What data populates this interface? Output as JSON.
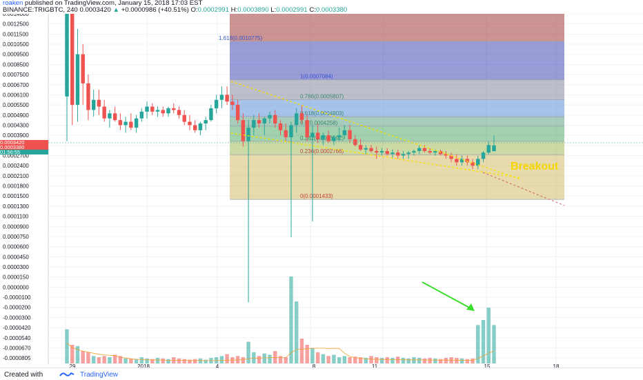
{
  "header": {
    "author": "roaken",
    "published_text": "published on TradingView.com, January 15, 2018 17:03 EST",
    "symbol": "BINANCE:TRIGBTC, 240",
    "last_price": "0.0003420",
    "change": "+0.0000986 (+40.51%)",
    "o_label": "O:",
    "o_value": "0.0002991",
    "h_label": "H:",
    "h_value": "0.0003890",
    "l_label": "L:",
    "l_value": "0.0002991",
    "c_label": "C:",
    "c_value": "0.0003380"
  },
  "price_badges": {
    "badge1": "0.0003420",
    "badge2": "0.0003380",
    "badge3": "01:56:55"
  },
  "footer": {
    "created_with": "Created with",
    "brand": "TradingView"
  },
  "colors": {
    "up": "#26a69a",
    "down": "#ef5350",
    "trendline": "#f6e000",
    "arrow": "#3bdc2c",
    "annotation": "#f6d400"
  },
  "chart_data": {
    "type": "candlestick",
    "title": "",
    "symbol": "BINANCE:TRIGBTC",
    "interval": "240",
    "y_axis_ticks": [
      "0.0014000",
      "0.0012500",
      "0.0011500",
      "0.0010500",
      "0.0009500",
      "0.0008500",
      "0.0007500",
      "0.0006700",
      "0.0006100",
      "0.0005500",
      "0.0004900",
      "0.0004300",
      "0.0003900",
      "0.0003380",
      "0.0002700",
      "0.0002400",
      "0.0002100",
      "0.0001800",
      "0.0001500",
      "0.0001300",
      "0.0001100",
      "0.0000900",
      "0.0000750",
      "0.0000600",
      "0.0000450",
      "0.0000300",
      "0.0000150",
      "0.0000000",
      "-0.0000100",
      "-0.0000200",
      "-0.0000300",
      "-0.0000420",
      "-0.0000540",
      "-0.0000670",
      "-0.0000805"
    ],
    "x_axis_ticks": [
      "29",
      "2018",
      "4",
      "8",
      "11",
      "15",
      "18"
    ],
    "fibonacci": [
      {
        "label": "1.618(0.0010775)",
        "value": 0.0010775
      },
      {
        "label": "1(0.0007084)",
        "value": 0.0007084
      },
      {
        "label": "0.786(0.0005807)",
        "value": 0.0005807
      },
      {
        "label": "0.618(0.0004803)",
        "value": 0.0004803
      },
      {
        "label": "0.5(0.0004258)",
        "value": 0.0004258
      },
      {
        "label": "0.382(0.0003592)",
        "value": 0.0003592
      },
      {
        "label": "0.236(0.0002766)",
        "value": 0.0002766
      },
      {
        "label": "0(0.0001433)",
        "value": 0.0001433
      }
    ],
    "annotations": [
      "Breakout"
    ],
    "candles": [
      {
        "o": 0.0006,
        "h": 0.0014,
        "l": 0.00036,
        "c": 0.0014
      },
      {
        "o": 0.0014,
        "h": 0.0014,
        "l": 0.00043,
        "c": 0.00055
      },
      {
        "o": 0.00055,
        "h": 0.0012,
        "l": 0.00045,
        "c": 0.00095
      },
      {
        "o": 0.00095,
        "h": 0.00105,
        "l": 0.00055,
        "c": 0.00068
      },
      {
        "o": 0.00068,
        "h": 0.00075,
        "l": 0.00046,
        "c": 0.00052
      },
      {
        "o": 0.00052,
        "h": 0.00064,
        "l": 0.00048,
        "c": 0.00058
      },
      {
        "o": 0.00058,
        "h": 0.00064,
        "l": 0.00049,
        "c": 0.00054
      },
      {
        "o": 0.00054,
        "h": 0.00058,
        "l": 0.00045,
        "c": 0.00047
      },
      {
        "o": 0.00047,
        "h": 0.00052,
        "l": 0.00042,
        "c": 0.0005
      },
      {
        "o": 0.0005,
        "h": 0.00054,
        "l": 0.00045,
        "c": 0.00046
      },
      {
        "o": 0.00046,
        "h": 0.0005,
        "l": 0.00041,
        "c": 0.00043
      },
      {
        "o": 0.00043,
        "h": 0.00048,
        "l": 0.0004,
        "c": 0.00045
      },
      {
        "o": 0.00045,
        "h": 0.0005,
        "l": 0.00041,
        "c": 0.00042
      },
      {
        "o": 0.00042,
        "h": 0.00049,
        "l": 0.0004,
        "c": 0.00047
      },
      {
        "o": 0.00047,
        "h": 0.00053,
        "l": 0.00045,
        "c": 0.00051
      },
      {
        "o": 0.00051,
        "h": 0.00057,
        "l": 0.00047,
        "c": 0.00054
      },
      {
        "o": 0.00054,
        "h": 0.00056,
        "l": 0.00049,
        "c": 0.00051
      },
      {
        "o": 0.00051,
        "h": 0.00054,
        "l": 0.00048,
        "c": 0.00052
      },
      {
        "o": 0.00052,
        "h": 0.00054,
        "l": 0.00048,
        "c": 0.0005
      },
      {
        "o": 0.0005,
        "h": 0.00054,
        "l": 0.00048,
        "c": 0.00053
      },
      {
        "o": 0.00053,
        "h": 0.00056,
        "l": 0.0005,
        "c": 0.00052
      },
      {
        "o": 0.00052,
        "h": 0.00054,
        "l": 0.00047,
        "c": 0.00049
      },
      {
        "o": 0.00049,
        "h": 0.00052,
        "l": 0.00043,
        "c": 0.00045
      },
      {
        "o": 0.00045,
        "h": 0.00049,
        "l": 0.00041,
        "c": 0.00043
      },
      {
        "o": 0.00043,
        "h": 0.00046,
        "l": 0.0004,
        "c": 0.00041
      },
      {
        "o": 0.00041,
        "h": 0.00045,
        "l": 0.00039,
        "c": 0.00044
      },
      {
        "o": 0.00044,
        "h": 0.00048,
        "l": 0.00041,
        "c": 0.00046
      },
      {
        "o": 0.00046,
        "h": 0.00055,
        "l": 0.00045,
        "c": 0.00053
      },
      {
        "o": 0.00053,
        "h": 0.00061,
        "l": 0.0005,
        "c": 0.00058
      },
      {
        "o": 0.00058,
        "h": 0.00066,
        "l": 0.00053,
        "c": 0.00061
      },
      {
        "o": 0.00061,
        "h": 0.00066,
        "l": 0.00055,
        "c": 0.00057
      },
      {
        "o": 0.00057,
        "h": 0.00061,
        "l": 0.00052,
        "c": 0.00055
      },
      {
        "o": 0.00055,
        "h": 0.00058,
        "l": 0.00044,
        "c": 0.00046
      },
      {
        "o": 0.00046,
        "h": 0.0005,
        "l": 0.00033,
        "c": 0.00036
      },
      {
        "o": 0.00036,
        "h": 0.00046,
        "l": -1.5e-05,
        "c": 0.00042
      },
      {
        "o": 0.00042,
        "h": 0.00049,
        "l": 0.00039,
        "c": 0.00046
      },
      {
        "o": 0.00046,
        "h": 0.0005,
        "l": 0.00042,
        "c": 0.00044
      },
      {
        "o": 0.00044,
        "h": 0.00048,
        "l": 0.00039,
        "c": 0.00047
      },
      {
        "o": 0.00047,
        "h": 0.00051,
        "l": 0.00044,
        "c": 0.00049
      },
      {
        "o": 0.00049,
        "h": 0.00052,
        "l": 0.00042,
        "c": 0.00044
      },
      {
        "o": 0.00044,
        "h": 0.00046,
        "l": 0.00039,
        "c": 0.00041
      },
      {
        "o": 0.00041,
        "h": 0.00044,
        "l": 0.00036,
        "c": 0.00038
      },
      {
        "o": 0.00038,
        "h": 0.00045,
        "l": 7.4e-05,
        "c": 0.00043
      },
      {
        "o": 0.00043,
        "h": 0.00053,
        "l": 0.0004,
        "c": 0.0005
      },
      {
        "o": 0.0005,
        "h": 0.00055,
        "l": 0.00044,
        "c": 0.00046
      },
      {
        "o": 0.00046,
        "h": 0.00049,
        "l": 0.00036,
        "c": 0.00038
      },
      {
        "o": 0.00038,
        "h": 0.00043,
        "l": 0.0001,
        "c": 0.0004
      },
      {
        "o": 0.0004,
        "h": 0.00044,
        "l": 0.00035,
        "c": 0.00037
      },
      {
        "o": 0.00037,
        "h": 0.0004,
        "l": 0.00034,
        "c": 0.00039
      },
      {
        "o": 0.00039,
        "h": 0.00041,
        "l": 0.00035,
        "c": 0.00036
      },
      {
        "o": 0.00036,
        "h": 0.00039,
        "l": 0.00034,
        "c": 0.00038
      },
      {
        "o": 0.00038,
        "h": 0.00042,
        "l": 0.00036,
        "c": 0.00039
      },
      {
        "o": 0.00039,
        "h": 0.00043,
        "l": 0.00037,
        "c": 0.00041
      },
      {
        "o": 0.00041,
        "h": 0.00043,
        "l": 0.00035,
        "c": 0.00037
      },
      {
        "o": 0.00037,
        "h": 0.00039,
        "l": 0.00033,
        "c": 0.00034
      },
      {
        "o": 0.00034,
        "h": 0.00037,
        "l": 0.0003,
        "c": 0.00031
      },
      {
        "o": 0.00031,
        "h": 0.00034,
        "l": 0.00028,
        "c": 0.00032
      },
      {
        "o": 0.00032,
        "h": 0.00034,
        "l": 0.00029,
        "c": 0.0003
      },
      {
        "o": 0.0003,
        "h": 0.00033,
        "l": 0.00026,
        "c": 0.00029
      },
      {
        "o": 0.00029,
        "h": 0.00032,
        "l": 0.00027,
        "c": 0.0003
      },
      {
        "o": 0.0003,
        "h": 0.00032,
        "l": 0.00027,
        "c": 0.00028
      },
      {
        "o": 0.00028,
        "h": 0.00031,
        "l": 0.00026,
        "c": 0.00029
      },
      {
        "o": 0.00029,
        "h": 0.00031,
        "l": 0.00026,
        "c": 0.00027
      },
      {
        "o": 0.00027,
        "h": 0.0003,
        "l": 0.00026,
        "c": 0.00028
      },
      {
        "o": 0.00028,
        "h": 0.0003,
        "l": 0.00026,
        "c": 0.00029
      },
      {
        "o": 0.00029,
        "h": 0.00031,
        "l": 0.00027,
        "c": 0.0003
      },
      {
        "o": 0.0003,
        "h": 0.00034,
        "l": 0.00028,
        "c": 0.00032
      },
      {
        "o": 0.00032,
        "h": 0.00034,
        "l": 0.00029,
        "c": 0.0003
      },
      {
        "o": 0.0003,
        "h": 0.00032,
        "l": 0.00028,
        "c": 0.00029
      },
      {
        "o": 0.00029,
        "h": 0.00031,
        "l": 0.00027,
        "c": 0.0003
      },
      {
        "o": 0.0003,
        "h": 0.00031,
        "l": 0.00027,
        "c": 0.00028
      },
      {
        "o": 0.00028,
        "h": 0.0003,
        "l": 0.00026,
        "c": 0.00027
      },
      {
        "o": 0.00027,
        "h": 0.00029,
        "l": 0.00025,
        "c": 0.00026
      },
      {
        "o": 0.00026,
        "h": 0.00028,
        "l": 0.00024,
        "c": 0.00025
      },
      {
        "o": 0.00025,
        "h": 0.00027,
        "l": 0.00024,
        "c": 0.00026
      },
      {
        "o": 0.00026,
        "h": 0.00027,
        "l": 0.00024,
        "c": 0.00025
      },
      {
        "o": 0.00025,
        "h": 0.00026,
        "l": 0.00023,
        "c": 0.00024
      },
      {
        "o": 0.00024,
        "h": 0.00027,
        "l": 0.00023,
        "c": 0.00026
      },
      {
        "o": 0.00026,
        "h": 0.0003,
        "l": 0.00025,
        "c": 0.00029
      },
      {
        "o": 0.00029,
        "h": 0.00036,
        "l": 0.00028,
        "c": 0.00034
      },
      {
        "o": 0.0002991,
        "h": 0.000389,
        "l": 0.0002991,
        "c": 0.000338
      }
    ],
    "volumes": [
      0.55,
      0.3,
      0.28,
      0.2,
      0.18,
      0.12,
      0.1,
      0.12,
      0.1,
      0.14,
      0.12,
      0.08,
      0.08,
      0.07,
      0.1,
      0.08,
      0.07,
      0.09,
      0.08,
      0.07,
      0.1,
      0.08,
      0.07,
      0.06,
      0.07,
      0.08,
      0.06,
      0.09,
      0.1,
      0.12,
      0.15,
      0.1,
      0.12,
      0.1,
      0.35,
      0.18,
      0.12,
      0.16,
      0.14,
      0.2,
      0.12,
      0.1,
      1.4,
      1.0,
      0.4,
      0.3,
      0.25,
      0.18,
      0.15,
      0.12,
      0.14,
      0.1,
      0.12,
      0.1,
      0.11,
      0.1,
      0.09,
      0.12,
      0.1,
      0.09,
      0.1,
      0.09,
      0.11,
      0.09,
      0.08,
      0.1,
      0.09,
      0.08,
      0.09,
      0.08,
      0.07,
      0.09,
      0.1,
      0.09,
      0.08,
      0.07,
      0.08,
      0.62,
      0.7,
      0.9,
      0.62
    ]
  }
}
